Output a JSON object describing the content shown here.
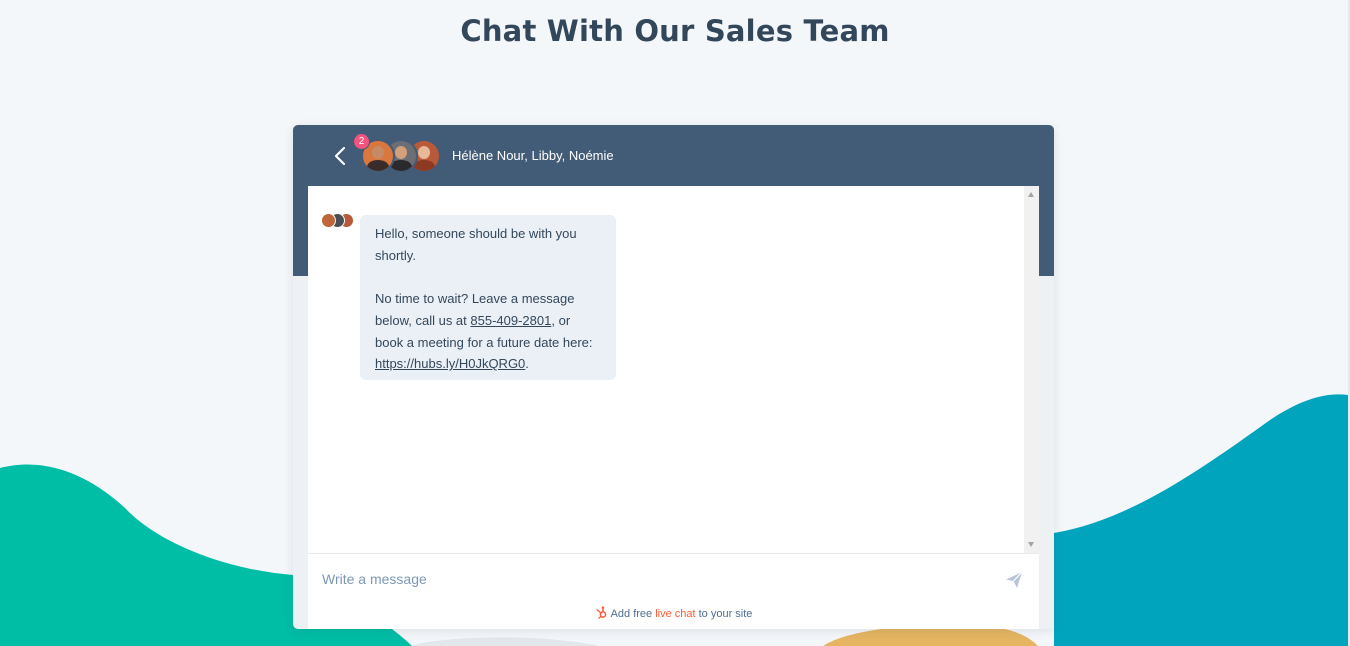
{
  "page": {
    "title": "Chat With Our Sales Team"
  },
  "colors": {
    "header": "#425b76",
    "title": "#33475b",
    "teal_wave": "#00bda5",
    "blue_wave": "#00a4bd",
    "yellow_wave": "#e5b562",
    "badge": "#f2547d",
    "bubble": "#eaf0f6",
    "brand_accent": "#ff5c35"
  },
  "chat": {
    "header": {
      "back_icon": "chevron-left-icon",
      "unread_count": "2",
      "agents": "Hélène Nour, Libby, Noémie"
    },
    "messages": [
      {
        "line1": "Hello, someone should be with you shortly.",
        "p2_before_phone": "No time to wait? Leave a message below, call us at ",
        "phone": "855-409-2801",
        "p2_after_phone": ", or book a meeting for a future date here: ",
        "link": "https://hubs.ly/H0JkQRG0",
        "p2_end": "."
      }
    ],
    "composer": {
      "placeholder": "Write a message",
      "send_icon": "paper-plane-icon"
    },
    "branding": {
      "icon": "hubspot-sprocket-icon",
      "prefix": "Add free ",
      "highlight": "live chat",
      "suffix": " to your site"
    }
  }
}
